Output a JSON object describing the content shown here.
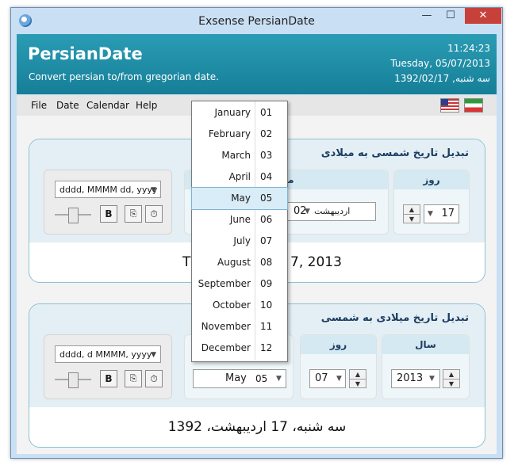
{
  "window": {
    "title": "Exsense PersianDate",
    "minimize": "—",
    "maximize": "☐",
    "close": "✕"
  },
  "header": {
    "brand": "PersianDate",
    "tagline": "Convert persian to/from gregorian date.",
    "time": "11:24:23",
    "gregorian_date": "Tuesday, 05/07/2013",
    "persian_date": "1392/02/17 ,سه شنبه"
  },
  "menu": [
    "File",
    "Date",
    "Calendar",
    "Help"
  ],
  "flags": [
    "us-flag",
    "iran-flag"
  ],
  "panel1": {
    "title": "تبدیل تاریخ شمسی به میلادی",
    "format": "dddd, MMMM dd, yyyy",
    "col_month_header": "ماه",
    "col_day_header": "روز",
    "month_name": "اردیبهشت",
    "month_num": "02",
    "day": "17",
    "result_left": "T",
    "result_right": "7, 2013"
  },
  "panel2": {
    "title": "تبدیل تاریخ میلادی به شمسی",
    "format": "dddd, d MMMM, yyyy",
    "col_day_header": "روز",
    "col_year_header": "سال",
    "month_name": "May",
    "month_num": "05",
    "day": "07",
    "year": "2013",
    "result": "سه شنبه، 17 اردیبهشت، 1392"
  },
  "buttons": {
    "bold": "B",
    "copy": "⎘",
    "clock": "⏱"
  },
  "month_dropdown": {
    "selected": "May",
    "items": [
      {
        "name": "January",
        "num": "01"
      },
      {
        "name": "February",
        "num": "02"
      },
      {
        "name": "March",
        "num": "03"
      },
      {
        "name": "April",
        "num": "04"
      },
      {
        "name": "May",
        "num": "05"
      },
      {
        "name": "June",
        "num": "06"
      },
      {
        "name": "July",
        "num": "07"
      },
      {
        "name": "August",
        "num": "08"
      },
      {
        "name": "September",
        "num": "09"
      },
      {
        "name": "October",
        "num": "10"
      },
      {
        "name": "November",
        "num": "11"
      },
      {
        "name": "December",
        "num": "12"
      }
    ]
  }
}
